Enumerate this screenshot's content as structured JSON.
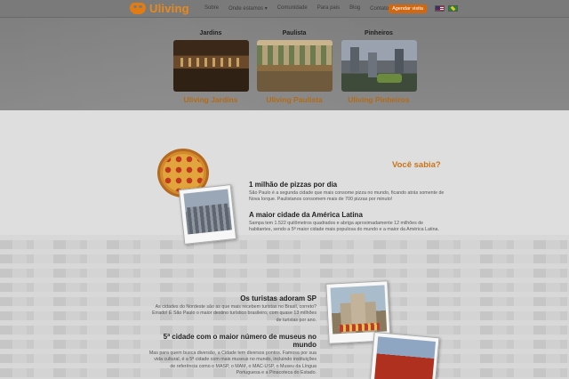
{
  "header": {
    "logo_text": "Uliving",
    "nav": [
      {
        "label": "Sobre"
      },
      {
        "label": "Onde estamos ▾"
      },
      {
        "label": "Comunidade"
      },
      {
        "label": "Para pais"
      },
      {
        "label": "Blog"
      },
      {
        "label": "Contato ▾"
      }
    ],
    "cta_label": "Agendar visita",
    "flags": [
      "us-flag-icon",
      "brazil-flag-icon"
    ]
  },
  "locations_menu": {
    "units": [
      {
        "heading": "Jardins",
        "link": "Uliving Jardins"
      },
      {
        "heading": "Paulista",
        "link": "Uliving Paulista"
      },
      {
        "heading": "Pinheiros",
        "link": "Uliving Pinheiros"
      }
    ]
  },
  "content": {
    "section_title": "Você sabia?",
    "facts": [
      {
        "title": "1 milhão de pizzas por dia",
        "text": "São Paulo é a segunda cidade que mais consome pizza no mundo, ficando atrás somente de Nova Iorque. Paulistanos consomem mais de 700 pizzas por minuto!"
      },
      {
        "title": "A maior cidade da América Latina",
        "text": "Sampa tem 1.522 quilômetros quadrados e abriga aproximadamente 12 milhões de habitantes, sendo a 5ª maior cidade mais populosa do mundo e a maior da América Latina."
      },
      {
        "title": "Os turistas adoram SP",
        "text": "As cidades do Nordeste são as que mais recebem turistas no Brasil, correto? Errado! É São Paulo o maior destino turístico brasileiro, com quase 13 milhões de turistas por ano."
      },
      {
        "title": "5ª cidade com o maior número de museus no mundo",
        "text": "Mas para quem busca diversão, a Cidade tem diversos pontos. Famosa por sua vida cultural, é a 5ª cidade com mais museus no mundo, incluindo instituições de referência como o MASP, o MAM, o MAC-USP, o Museu da Língua Portuguesa e a Pinacoteca do Estado."
      }
    ]
  },
  "colors": {
    "accent": "#e8891c",
    "cta": "#d1680f",
    "overlay": "#808080"
  }
}
